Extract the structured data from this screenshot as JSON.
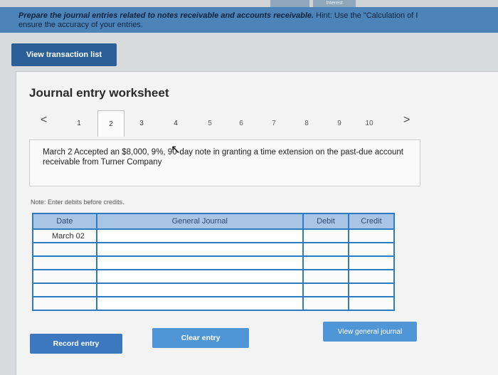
{
  "header": {
    "top_tabs": [
      "",
      "Interest"
    ],
    "instruction_bold": "Prepare the journal entries related to notes receivable and accounts receivable.",
    "instruction_hint": " Hint: Use the \"Calculation of I",
    "instruction_line2": "ensure the accuracy of your entries."
  },
  "toolbar": {
    "view_transaction_list": "View transaction list"
  },
  "worksheet": {
    "title": "Journal entry worksheet",
    "pager": {
      "prev": "<",
      "next": ">",
      "pages": [
        "1",
        "2",
        "3",
        "4",
        "5",
        "6",
        "7",
        "8",
        "9",
        "10"
      ],
      "active_index": 1
    },
    "scenario": "March 2 Accepted an $8,000, 9%, 90-day note in granting a time extension on the past-due account receivable from Turner Company",
    "note": "Note: Enter debits before credits."
  },
  "journal_table": {
    "headers": {
      "date": "Date",
      "general_journal": "General Journal",
      "debit": "Debit",
      "credit": "Credit"
    },
    "rows": [
      {
        "date": "March 02",
        "general_journal": "",
        "debit": "",
        "credit": ""
      },
      {
        "date": "",
        "general_journal": "",
        "debit": "",
        "credit": ""
      },
      {
        "date": "",
        "general_journal": "",
        "debit": "",
        "credit": ""
      },
      {
        "date": "",
        "general_journal": "",
        "debit": "",
        "credit": ""
      },
      {
        "date": "",
        "general_journal": "",
        "debit": "",
        "credit": ""
      },
      {
        "date": "",
        "general_journal": "",
        "debit": "",
        "credit": ""
      }
    ]
  },
  "buttons": {
    "record_entry": "Record entry",
    "clear_entry": "Clear entry",
    "view_general_journal": "View general journal"
  }
}
